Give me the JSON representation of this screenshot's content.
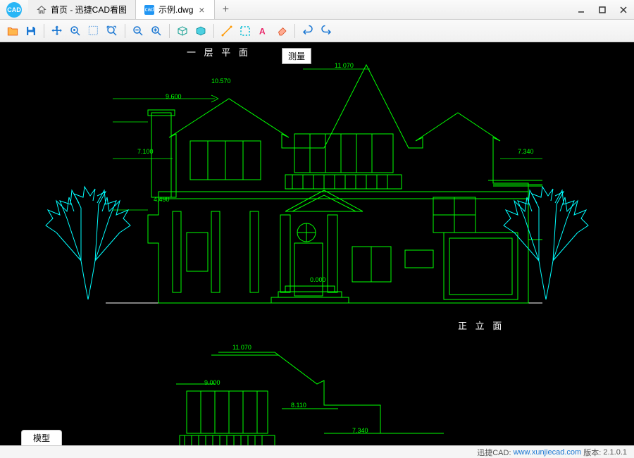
{
  "app_name": "迅捷CAD看图",
  "tabs": {
    "home_label": "首页 - 迅捷CAD看图",
    "file_label": "示例.dwg"
  },
  "tooltip": "测量",
  "drawing_labels": {
    "plan_title": "一 层 平 面",
    "elevation_title": "正 立 面"
  },
  "dimensions": {
    "d1": "10.570",
    "d2": "11.070",
    "d3": "9.600",
    "d4": "7.100",
    "d5": "7.340",
    "d6": "4.490",
    "d7": "0.000",
    "d8": "11.070",
    "d9": "9.000",
    "d10": "8.110",
    "d11": "7.340"
  },
  "bottom_tab": "模型",
  "status": {
    "brand": "迅捷CAD:",
    "url": "www.xunjiecad.com",
    "version_label": "版本:",
    "version": "2.1.0.1"
  }
}
